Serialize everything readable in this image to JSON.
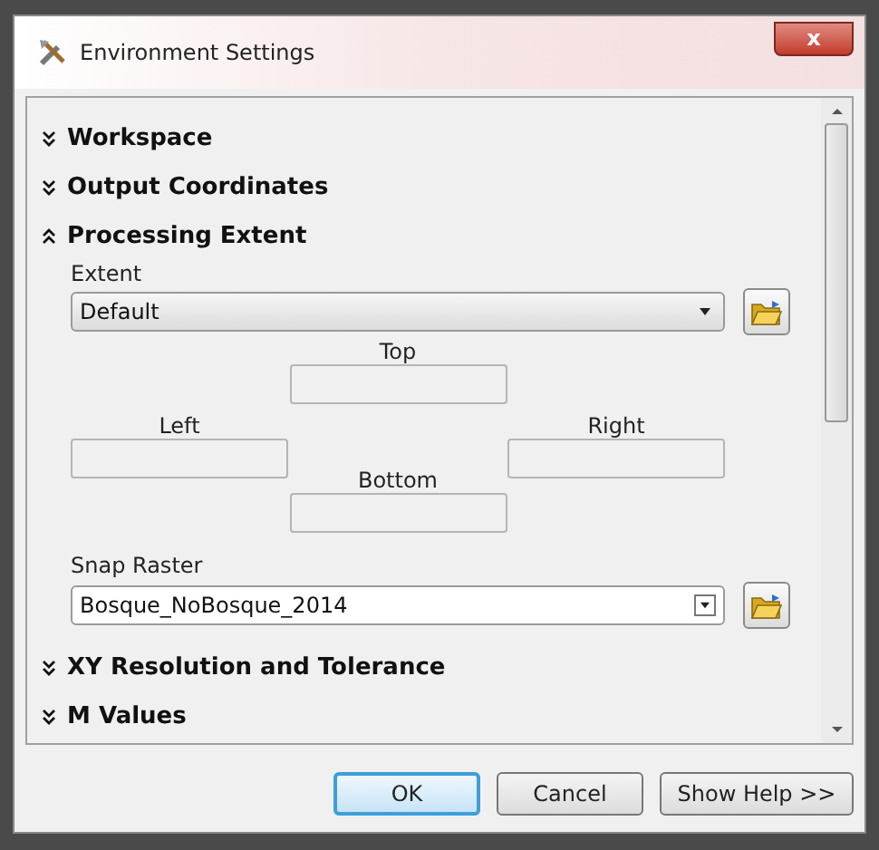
{
  "window": {
    "title": "Environment Settings",
    "close": "x"
  },
  "sections": [
    {
      "title": "Workspace",
      "expanded": false
    },
    {
      "title": "Output Coordinates",
      "expanded": false
    },
    {
      "title": "Processing Extent",
      "expanded": true,
      "extent": {
        "label": "Extent",
        "value": "Default"
      },
      "top": "Top",
      "left": "Left",
      "right": "Right",
      "bottom": "Bottom",
      "snap": {
        "label": "Snap Raster",
        "value": "Bosque_NoBosque_2014"
      }
    },
    {
      "title": "XY Resolution and Tolerance",
      "expanded": false
    },
    {
      "title": "M Values",
      "expanded": false
    }
  ],
  "buttons": [
    {
      "label": "OK",
      "default": true
    },
    {
      "label": "Cancel",
      "default": false
    },
    {
      "label": "Show Help >>",
      "default": false
    }
  ]
}
